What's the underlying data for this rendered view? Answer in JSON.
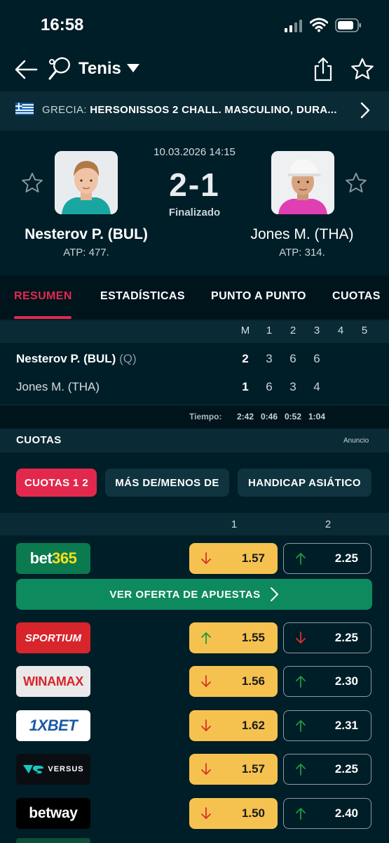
{
  "status_bar": {
    "time": "16:58"
  },
  "header": {
    "sport": "Tenis"
  },
  "league": {
    "country": "GRECIA:",
    "name": "HERSONISSOS 2 CHALL. MASCULINO, DURA..."
  },
  "match": {
    "datetime": "10.03.2026 14:15",
    "score": "2-1",
    "status": "Finalizado",
    "player1": {
      "name": "Nesterov P. (BUL)",
      "rank": "ATP: 477."
    },
    "player2": {
      "name": "Jones M. (THA)",
      "rank": "ATP: 314."
    }
  },
  "tabs": [
    "RESUMEN",
    "ESTADÍSTICAS",
    "PUNTO A PUNTO",
    "CUOTAS"
  ],
  "scoreboard": {
    "headers": [
      "M",
      "1",
      "2",
      "3",
      "4",
      "5"
    ],
    "rows": [
      {
        "name": "Nesterov P. (BUL)",
        "tag": "(Q)",
        "sets": "2",
        "games": [
          "3",
          "6",
          "6"
        ]
      },
      {
        "name": "Jones M. (THA)",
        "tag": "",
        "sets": "1",
        "games": [
          "6",
          "3",
          "4"
        ]
      }
    ],
    "time_label": "Tiempo:",
    "times": [
      "2:42",
      "0:46",
      "0:52",
      "1:04"
    ]
  },
  "odds_section": {
    "title": "CUOTAS",
    "ad_label": "Anuncio",
    "chips": [
      "CUOTAS 1 2",
      "MÁS DE/MENOS DE",
      "HANDICAP ASIÁTICO"
    ],
    "col1": "1",
    "col2": "2",
    "cta": "VER OFERTA DE APUESTAS",
    "bookmakers": [
      {
        "name": "bet365",
        "odd1": "1.57",
        "dir1": "down",
        "odd2": "2.25",
        "dir2": "up"
      },
      {
        "name": "SPORTIUM",
        "odd1": "1.55",
        "dir1": "up",
        "odd2": "2.25",
        "dir2": "down"
      },
      {
        "name": "WINAMAX",
        "odd1": "1.56",
        "dir1": "down",
        "odd2": "2.30",
        "dir2": "up"
      },
      {
        "name": "1XBET",
        "odd1": "1.62",
        "dir1": "down",
        "odd2": "2.31",
        "dir2": "up"
      },
      {
        "name": "VERSUS",
        "odd1": "1.57",
        "dir1": "down",
        "odd2": "2.25",
        "dir2": "up"
      },
      {
        "name": "betway",
        "odd1": "1.50",
        "dir1": "down",
        "odd2": "2.40",
        "dir2": "up"
      }
    ]
  },
  "colors": {
    "accent": "#e2294d",
    "highlight": "#f6c24f",
    "cta": "#0e8a5f",
    "background": "#001e28"
  }
}
